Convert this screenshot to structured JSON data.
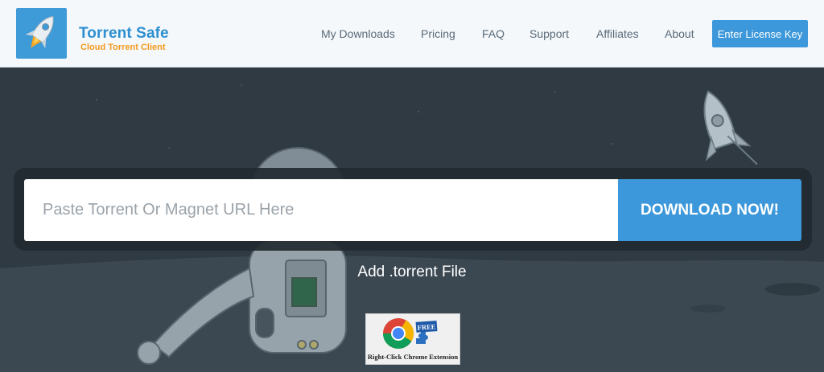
{
  "brand": {
    "name": "Torrent Safe",
    "tagline": "Cloud Torrent Client"
  },
  "nav": [
    {
      "label": "My Downloads"
    },
    {
      "label": "Pricing"
    },
    {
      "label": "FAQ"
    },
    {
      "label": "Support"
    },
    {
      "label": "Affiliates"
    },
    {
      "label": "About"
    }
  ],
  "license_button": "Enter License Key",
  "search": {
    "placeholder": "Paste Torrent Or Magnet URL Here",
    "value": ""
  },
  "download_button": "DOWNLOAD NOW!",
  "add_file_link": "Add .torrent File",
  "chrome_extension": {
    "badge": "FREE",
    "caption": "Right-Click Chrome Extension"
  },
  "colors": {
    "accent": "#3c98da",
    "brand_orange": "#f59a1c",
    "hero_bg": "#2f3a42"
  }
}
